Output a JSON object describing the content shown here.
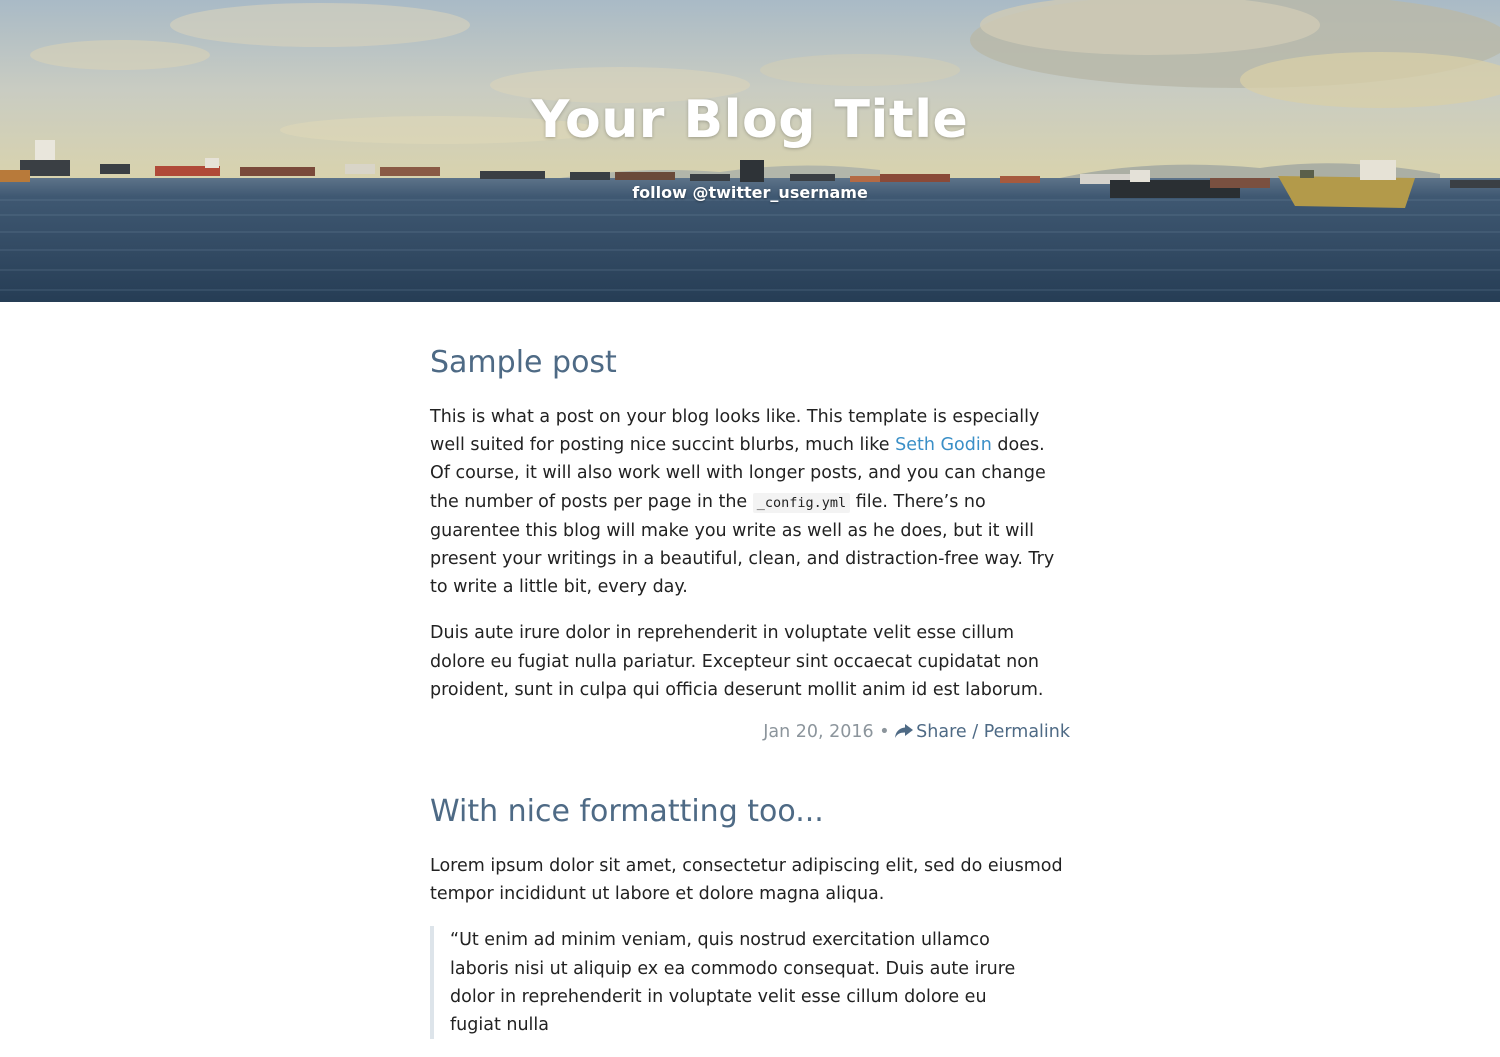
{
  "header": {
    "blog_title": "Your Blog Title",
    "follow_text": "follow @twitter_username"
  },
  "posts": [
    {
      "title": "Sample post",
      "p1": {
        "part1": "This is what a post on your blog looks like. This template is especially well suited for posting nice succint blurbs, much like ",
        "link": "Seth Godin",
        "part2": " does. Of course, it will also work well with longer posts, and you can change the number of posts per page in the ",
        "code": "_config.yml",
        "part3": " file. There’s no guarentee this blog will make you write as well as he does, but it will present your writings in a beautiful, clean, and distraction-free way. Try to write a little bit, every day."
      },
      "p2": "Duis aute irure dolor in reprehenderit in voluptate velit esse cillum dolore eu fugiat nulla pariatur. Excepteur sint occaecat cupidatat non proident, sunt in culpa qui officia deserunt mollit anim id est laborum.",
      "date": "Jan 20, 2016",
      "separator": "•",
      "share_label": "Share / Permalink",
      "share_icon": "share-icon"
    },
    {
      "title": "With nice formatting too...",
      "p1": "Lorem ipsum dolor sit amet, consectetur adipiscing elit, sed do eiusmod tempor incididunt ut labore et dolore magna aliqua.",
      "quote": "“Ut enim ad minim veniam, quis nostrud exercitation ullamco laboris nisi ut aliquip ex ea commodo consequat. Duis aute irure dolor in reprehenderit in voluptate velit esse cillum dolore eu fugiat nulla"
    }
  ],
  "colors": {
    "title_color": "#4e6a85",
    "link_color": "#3a8fc7",
    "meta_color": "#8c959c"
  }
}
